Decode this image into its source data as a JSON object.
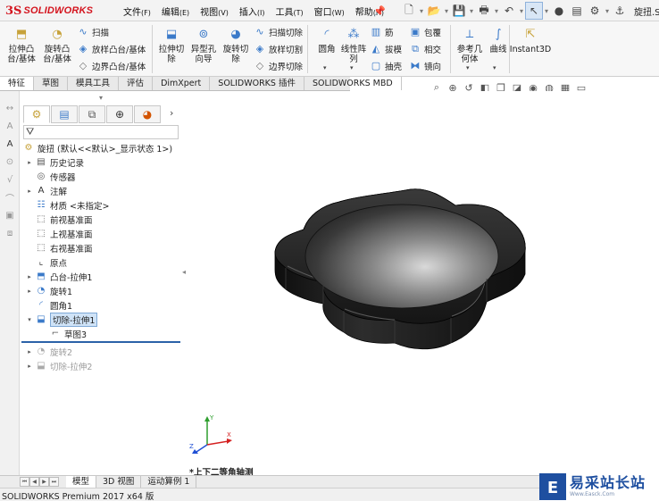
{
  "app": {
    "brand": "SOLIDWORKS",
    "document_title": "旋扭.SL",
    "status_text": "SOLIDWORKS Premium 2017 x64 版"
  },
  "menubar": {
    "items": [
      {
        "label": "文件",
        "key": "(F)"
      },
      {
        "label": "编辑",
        "key": "(E)"
      },
      {
        "label": "视图",
        "key": "(V)"
      },
      {
        "label": "插入",
        "key": "(I)"
      },
      {
        "label": "工具",
        "key": "(T)"
      },
      {
        "label": "窗口",
        "key": "(W)"
      },
      {
        "label": "帮助",
        "key": "(H)"
      }
    ]
  },
  "ribbon": {
    "extrude_boss": "拉伸凸\n台/基体",
    "revolve_boss": "旋转凸\n台/基体",
    "sweep": "扫描",
    "loft_boss": "放样凸台/基体",
    "boundary_boss": "边界凸台/基体",
    "extrude_cut": "拉伸切\n除",
    "hole_wizard": "异型孔\n向导",
    "revolve_cut": "旋转切\n除",
    "sweep_cut": "扫描切除",
    "loft_cut": "放样切割",
    "boundary_cut": "边界切除",
    "fillet": "圆角",
    "linear_pattern": "线性阵\n列",
    "rib": "筋",
    "draft": "拔模",
    "shell": "抽壳",
    "wrap": "包覆",
    "intersect": "相交",
    "mirror": "镜向",
    "ref_geometry": "参考几\n何体",
    "curves": "曲线",
    "instant3d": "Instant3D"
  },
  "tabs": [
    "特征",
    "草图",
    "模具工具",
    "评估",
    "DimXpert",
    "SOLIDWORKS 插件",
    "SOLIDWORKS MBD"
  ],
  "feature_tree": {
    "root": "旋扭 (默认<<默认>_显示状态 1>)",
    "items": [
      {
        "label": "历史记录",
        "icon": "history-icon"
      },
      {
        "label": "传感器",
        "icon": "sensor-icon"
      },
      {
        "label": "注解",
        "icon": "annotation-icon"
      },
      {
        "label": "材质 <未指定>",
        "icon": "material-icon"
      },
      {
        "label": "前视基准面",
        "icon": "plane-icon"
      },
      {
        "label": "上视基准面",
        "icon": "plane-icon"
      },
      {
        "label": "右视基准面",
        "icon": "plane-icon"
      },
      {
        "label": "原点",
        "icon": "origin-icon"
      },
      {
        "label": "凸台-拉伸1",
        "icon": "extrude-icon"
      },
      {
        "label": "旋转1",
        "icon": "revolve-icon"
      },
      {
        "label": "圆角1",
        "icon": "fillet-icon"
      },
      {
        "label": "切除-拉伸1",
        "icon": "cut-extrude-icon"
      },
      {
        "label": "草图3",
        "icon": "sketch-icon"
      },
      {
        "label": "旋转2",
        "icon": "revolve-icon"
      },
      {
        "label": "切除-拉伸2",
        "icon": "cut-extrude-icon"
      }
    ]
  },
  "graphics": {
    "view_label": "*上下二等角轴测",
    "triad": {
      "x": "X",
      "y": "Y",
      "z": "Z"
    }
  },
  "bottom_tabs": [
    "模型",
    "3D 视图",
    "运动算例 1"
  ],
  "watermark": {
    "main": "易采站长站",
    "sub": "Www.Easck.Com"
  },
  "colors": {
    "brand_red": "#d4141e",
    "selection_blue": "#cfe3f7",
    "rollback_bar": "#2b62a8",
    "model_black": "#1a1a1a"
  }
}
